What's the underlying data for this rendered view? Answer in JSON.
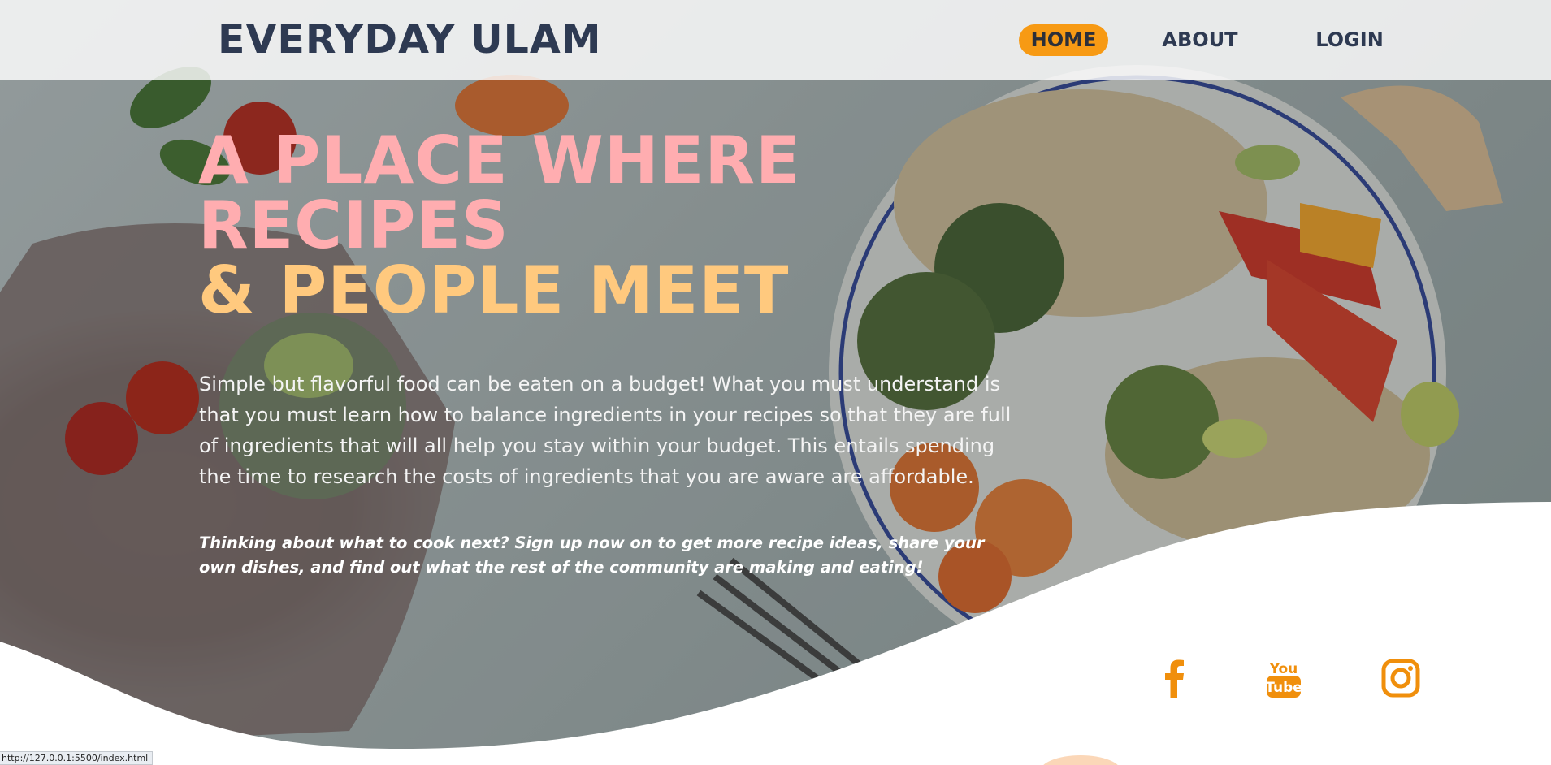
{
  "site": {
    "logo": "EVERYDAY ULAM"
  },
  "nav": {
    "items": [
      {
        "label": "HOME",
        "active": true
      },
      {
        "label": "ABOUT",
        "active": false
      },
      {
        "label": "LOGIN",
        "active": false
      }
    ]
  },
  "hero": {
    "headline_line1": "A PLACE WHERE",
    "headline_line2": "RECIPES",
    "headline_line3": "& PEOPLE MEET",
    "intro": "Simple but flavorful food can be eaten on a budget! What you must understand is that you must learn how to balance ingredients in your recipes so that they are full of ingredients that will all help you stay within your budget. This entails spending the time to research the costs of ingredients that you are aware are affordable.",
    "cta": "Thinking about what to cook next? Sign up now on to get more recipe ideas, share your own dishes, and find out what the rest of the community are making and eating!"
  },
  "social": {
    "links": [
      {
        "name": "facebook-icon"
      },
      {
        "name": "youtube-icon",
        "text_top": "You",
        "text_bottom": "Tube"
      },
      {
        "name": "instagram-icon"
      }
    ]
  },
  "status_bar": {
    "url": "http://127.0.0.1:5500/index.html"
  },
  "colors": {
    "accent": "#f79a14",
    "headline_pink": "#ffadb0",
    "headline_yellow": "#ffc97e",
    "nav_text": "#2e3a52",
    "icon_orange": "#f08f0c"
  }
}
